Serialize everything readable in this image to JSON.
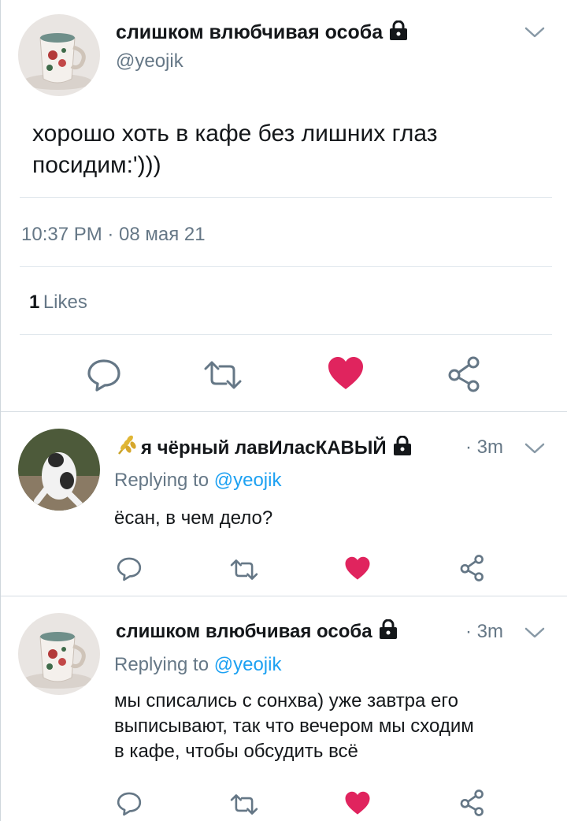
{
  "colors": {
    "like_red": "#e0245e",
    "mention_blue": "#1da1f2",
    "secondary_gray": "#657786",
    "divider": "#e1e8ed"
  },
  "main_tweet": {
    "author_name": "слишком влюбчивая особа",
    "author_handle": "@yeojik",
    "text_line1": "хорошо хоть в кафе без лишних глаз",
    "text_line2": "посидим:')))",
    "timestamp": "10:37 PM · 08 мая 21",
    "likes_count": "1",
    "likes_label": "Likes",
    "icons": [
      "lock-icon",
      "chevron-down-icon",
      "reply-icon",
      "retweet-icon",
      "like-heart-filled-icon",
      "share-icon"
    ]
  },
  "replies": [
    {
      "author_name": "я чёрный лавИласКАВЫЙ",
      "name_emoji": "wheat-icon",
      "time": "· 3m",
      "replying_prefix": "Replying to",
      "replying_handle": "@yeojik",
      "text_lines": [
        "ёсан, в чем дело?"
      ],
      "liked": true
    },
    {
      "author_name": "слишком влюбчивая особа",
      "time": "· 3m",
      "replying_prefix": "Replying to",
      "replying_handle": "@yeojik",
      "text_lines": [
        "мы списались с сонхва) уже завтра его",
        "выписывают, так что вечером мы сходим",
        "в кафе, чтобы обсудить всё"
      ],
      "liked": true
    }
  ]
}
